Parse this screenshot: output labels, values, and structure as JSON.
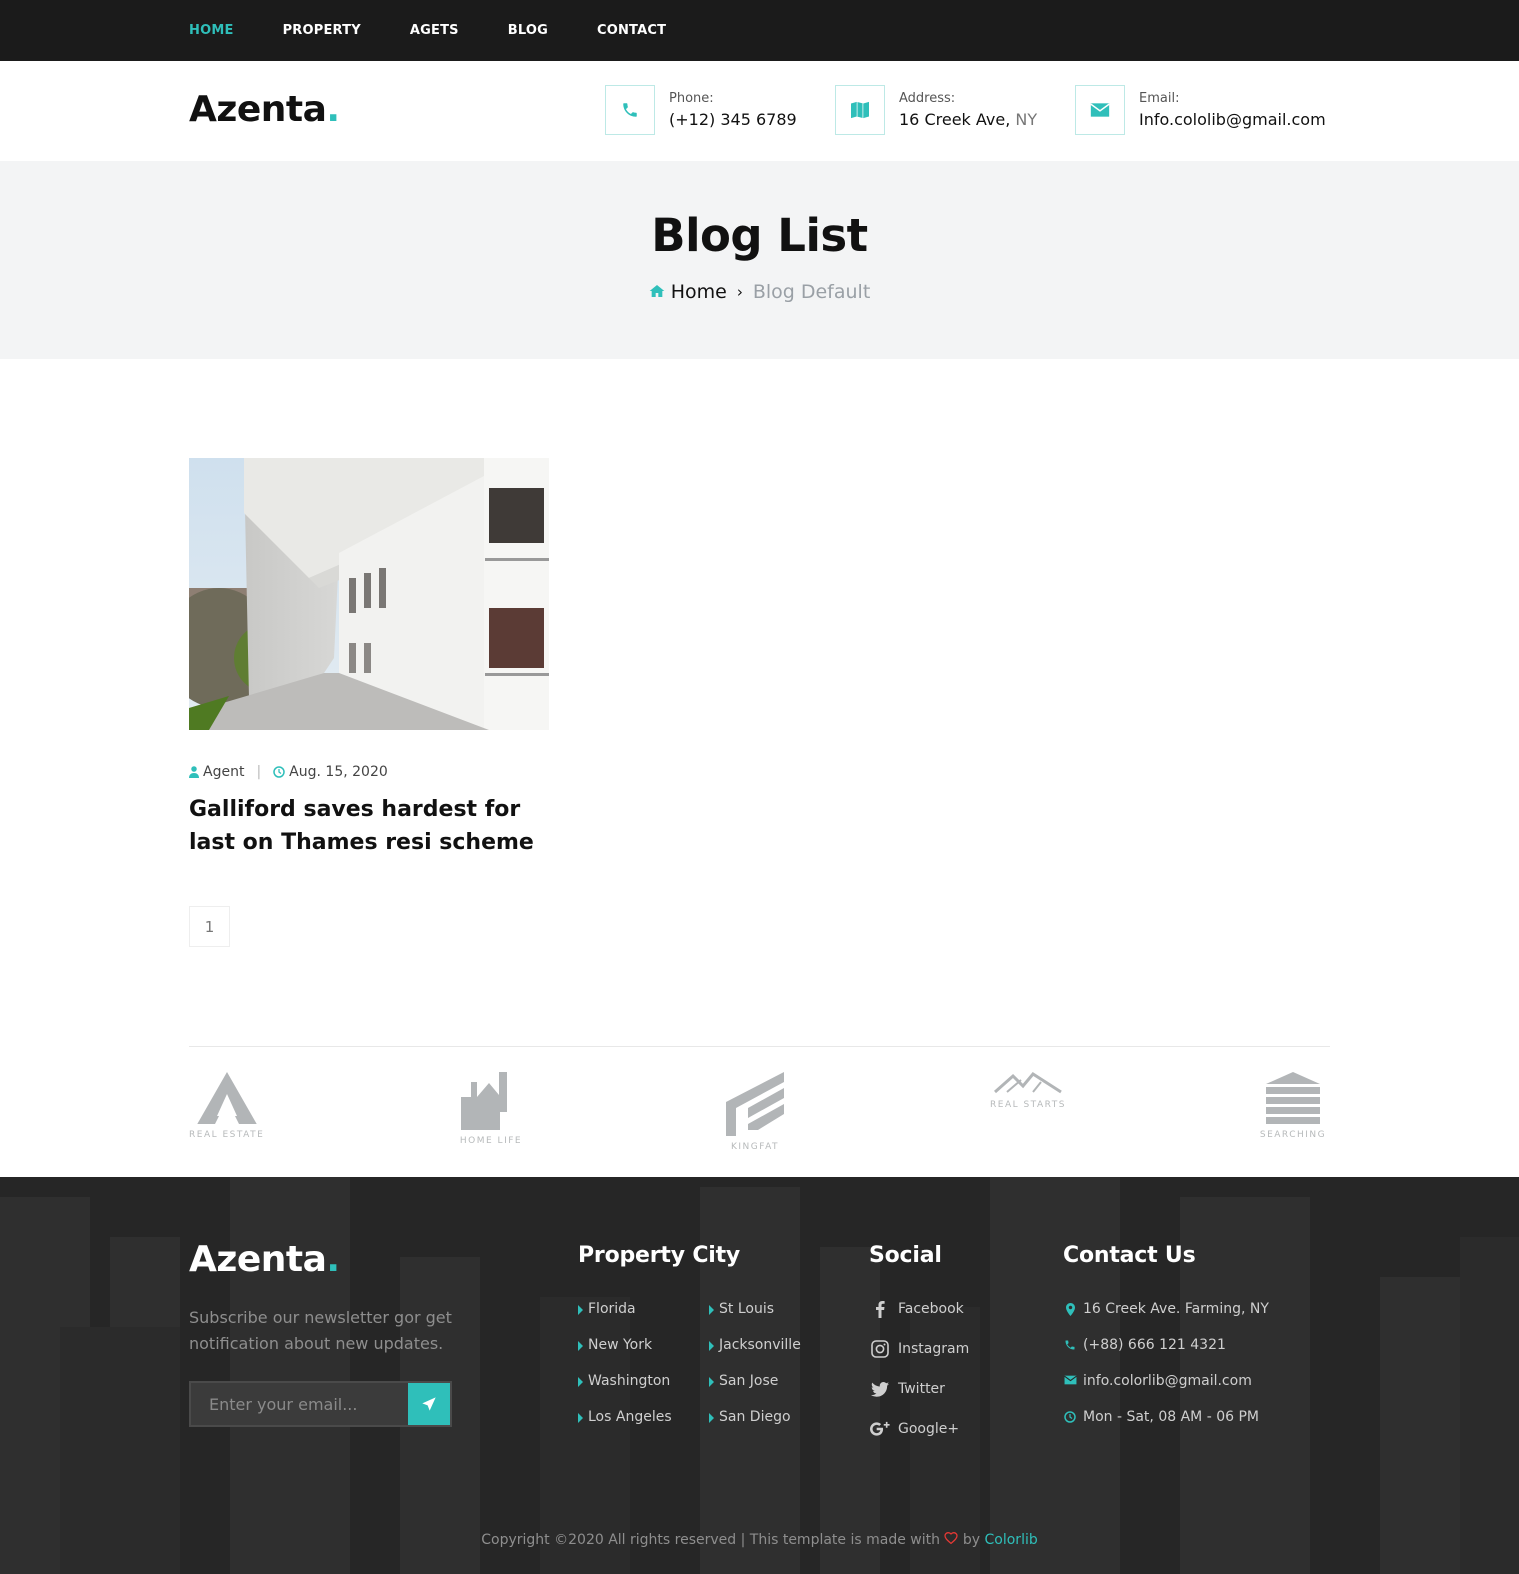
{
  "nav": {
    "items": [
      {
        "label": "HOME",
        "active": true
      },
      {
        "label": "PROPERTY",
        "active": false
      },
      {
        "label": "AGETS",
        "active": false
      },
      {
        "label": "BLOG",
        "active": false
      },
      {
        "label": "CONTACT",
        "active": false
      }
    ]
  },
  "brand": {
    "name": "Azenta",
    "dot": ".",
    "accent": "#2fbfba"
  },
  "header": {
    "phone": {
      "label": "Phone:",
      "value": "(+12) 345 6789",
      "icon": "phone-icon"
    },
    "address": {
      "label": "Address:",
      "value": "16 Creek Ave,",
      "value_suffix": "NY",
      "icon": "map-icon"
    },
    "email": {
      "label": "Email:",
      "value": "Info.cololib@gmail.com",
      "icon": "envelope-icon"
    }
  },
  "hero": {
    "title": "Blog List",
    "breadcrumb": {
      "home": "Home",
      "separator": "›",
      "current": "Blog Default"
    }
  },
  "post": {
    "author": "Agent",
    "date": "Aug. 15, 2020",
    "title": "Galliford saves hardest for last on Thames resi scheme"
  },
  "pagination": {
    "pages": [
      "1"
    ]
  },
  "partners": [
    {
      "name": "REAL ESTATE"
    },
    {
      "name": "HOME LIFE"
    },
    {
      "name": "KINGFAT"
    },
    {
      "name": "REAL STARTS"
    },
    {
      "name": "SEARCHING"
    }
  ],
  "footer": {
    "description": "Subscribe our newsletter gor get notification about new updates.",
    "subscribe_placeholder": "Enter your email...",
    "property_city": {
      "heading": "Property City",
      "col1": [
        "Florida",
        "New York",
        "Washington",
        "Los Angeles"
      ],
      "col2": [
        "St Louis",
        "Jacksonville",
        "San Jose",
        "San Diego"
      ]
    },
    "social": {
      "heading": "Social",
      "items": [
        {
          "label": "Facebook",
          "icon": "facebook-icon"
        },
        {
          "label": "Instagram",
          "icon": "instagram-icon"
        },
        {
          "label": "Twitter",
          "icon": "twitter-icon"
        },
        {
          "label": "Google+",
          "icon": "google-plus-icon"
        }
      ]
    },
    "contact": {
      "heading": "Contact Us",
      "address": "16 Creek Ave. Farming, NY",
      "phone": "(+88) 666 121 4321",
      "email": "info.colorlib@gmail.com",
      "hours": "Mon - Sat, 08 AM - 06 PM"
    },
    "copyright_prefix": "Copyright ©2020 All rights reserved | This template is made with",
    "copyright_by": "by",
    "copyright_link": "Colorlib"
  }
}
